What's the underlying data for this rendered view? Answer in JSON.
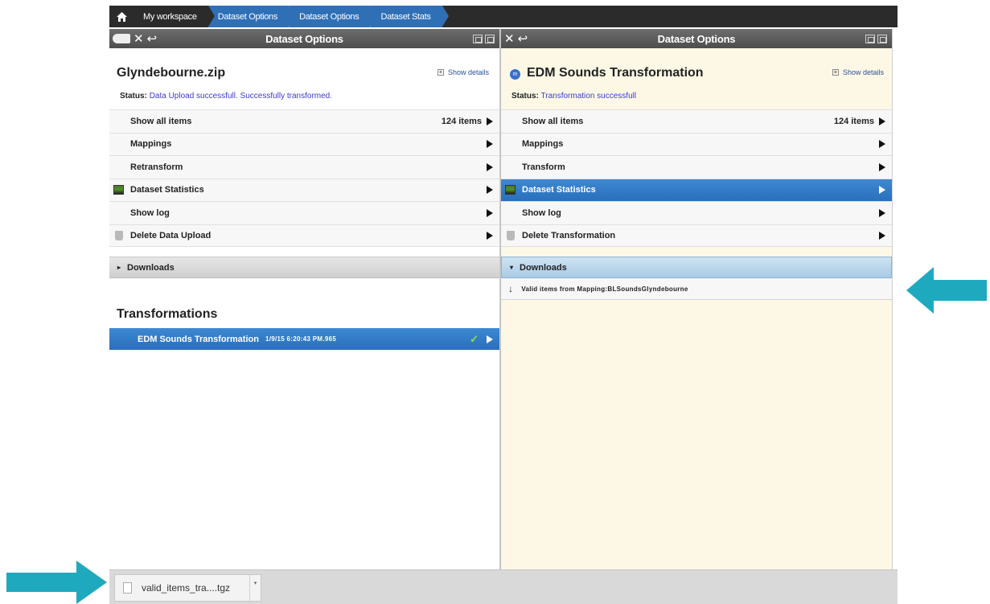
{
  "breadcrumb": {
    "home_icon": "home-icon",
    "items": [
      "My workspace",
      "Dataset Options",
      "Dataset Options",
      "Dataset Stats"
    ]
  },
  "left_panel": {
    "header_title": "Dataset Options",
    "dataset_name": "Glyndebourne.zip",
    "show_details": "Show details",
    "status_label": "Status:",
    "status_value": "Data Upload successfull. Successfully transformed.",
    "items": [
      {
        "label": "Show all items",
        "count": "124 items"
      },
      {
        "label": "Mappings"
      },
      {
        "label": "Retransform"
      },
      {
        "label": "Dataset Statistics"
      },
      {
        "label": "Show log"
      },
      {
        "label": "Delete Data Upload"
      }
    ],
    "downloads_label": "Downloads",
    "transformations_title": "Transformations",
    "transformation_item": {
      "label": "EDM Sounds Transformation",
      "date": "1/9/15 6:20:43 PM.965"
    }
  },
  "right_panel": {
    "header_title": "Dataset Options",
    "title": "EDM Sounds Transformation",
    "show_details": "Show details",
    "status_label": "Status:",
    "status_value": "Transformation successfull",
    "items": [
      {
        "label": "Show all items",
        "count": "124 items"
      },
      {
        "label": "Mappings"
      },
      {
        "label": "Transform"
      },
      {
        "label": "Dataset Statistics"
      },
      {
        "label": "Show log"
      },
      {
        "label": "Delete Transformation"
      }
    ],
    "downloads_label": "Downloads",
    "download_item": "Valid items from Mapping:BLSoundsGlyndebourne"
  },
  "download_bar": {
    "file_name": "valid_items_tra....tgz"
  },
  "colors": {
    "accent_blue": "#2f6fb6",
    "teal_arrow": "#1fa9bf",
    "right_panel_bg": "#fdf8e6"
  }
}
